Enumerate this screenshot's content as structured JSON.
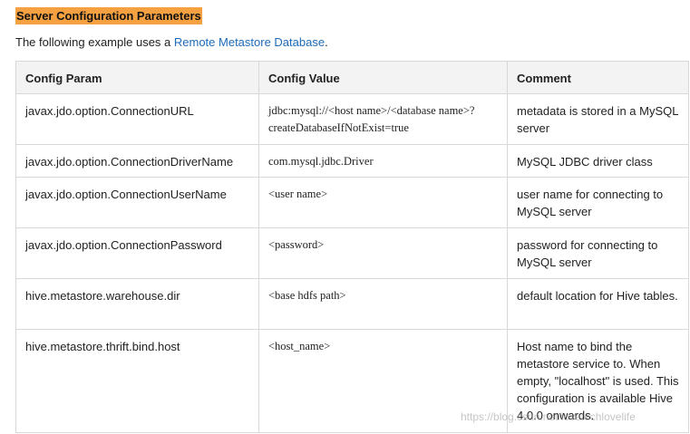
{
  "heading": "Server Configuration Parameters",
  "intro": {
    "prefix": "The following example uses a ",
    "link": "Remote Metastore Database",
    "suffix": "."
  },
  "table": {
    "headers": [
      "Config Param",
      "Config Value",
      "Comment"
    ],
    "rows": [
      {
        "param": "javax.jdo.option.ConnectionURL",
        "value": "jdbc:mysql://<host name>/<database name>?createDatabaseIfNotExist=true",
        "comment": "metadata is stored in a MySQL server"
      },
      {
        "param": "javax.jdo.option.ConnectionDriverName",
        "value": "com.mysql.jdbc.Driver",
        "comment": "MySQL JDBC driver class"
      },
      {
        "param": "javax.jdo.option.ConnectionUserName",
        "value": "<user name>",
        "comment": "user name for connecting to MySQL server"
      },
      {
        "param": "javax.jdo.option.ConnectionPassword",
        "value": "<password>",
        "comment": "password for connecting to MySQL server"
      },
      {
        "param": "hive.metastore.warehouse.dir",
        "value": "<base hdfs path>",
        "comment": "default location for Hive tables."
      },
      {
        "param": "hive.metastore.thrift.bind.host",
        "value": "<host_name>",
        "comment": "Host name to bind the metastore service to. When empty, \"localhost\" is used. This configuration is available Hive 4.0.0 onwards."
      }
    ]
  },
  "watermark": "https://blog.csdn.net/lovetechlovelife"
}
